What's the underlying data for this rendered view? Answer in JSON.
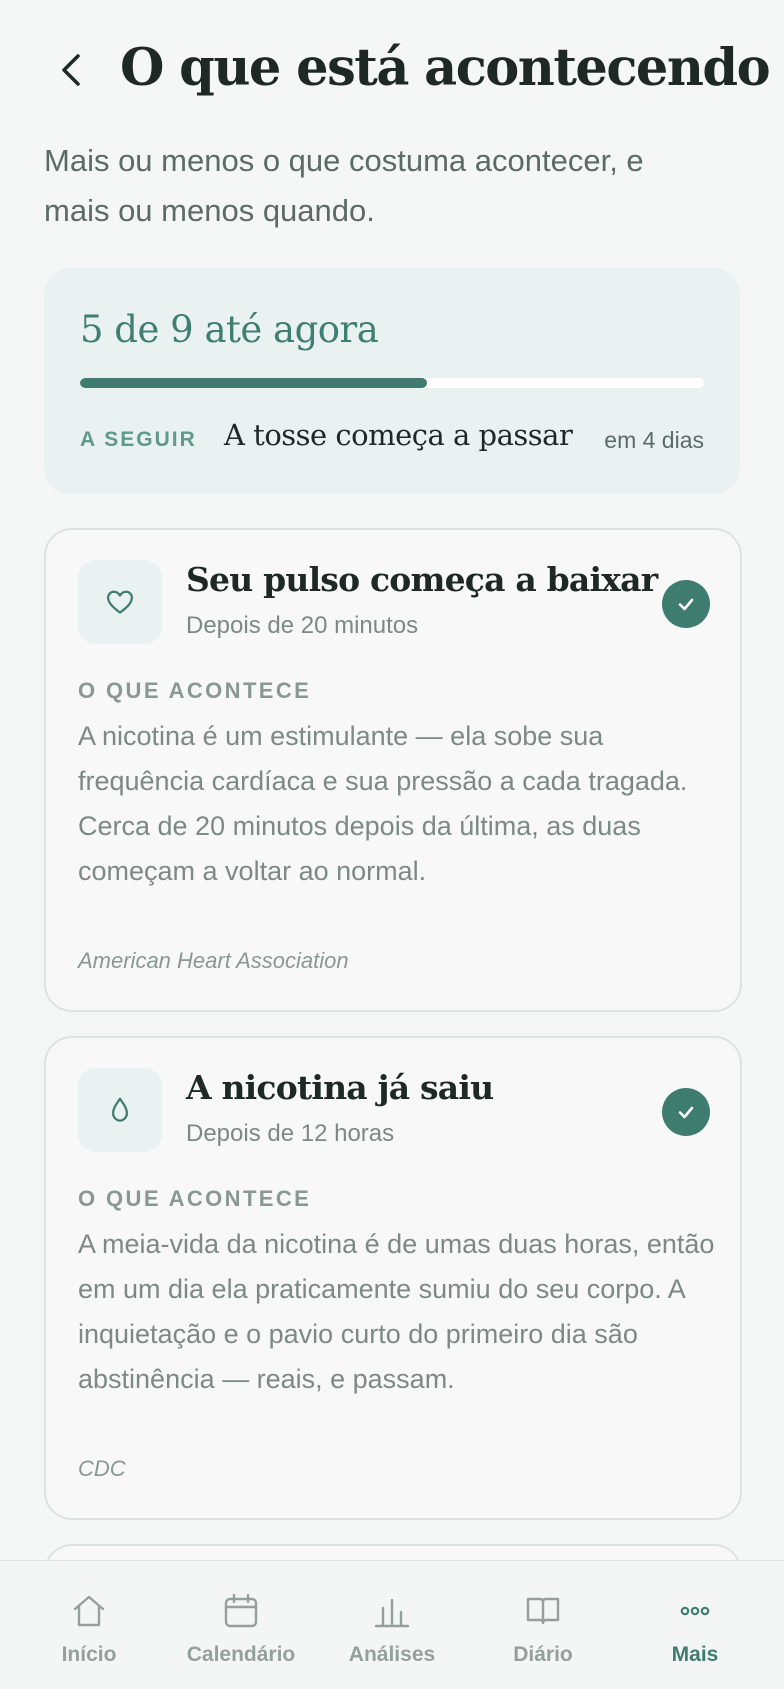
{
  "header": {
    "title": "O que está acontecendo",
    "subtitle": "Mais ou menos o que costuma acontecer, e mais ou menos quando."
  },
  "progress": {
    "title": "5 de 9 até agora",
    "completed": 5,
    "total": 9,
    "fraction": 0.556,
    "next_label": "A SEGUIR",
    "next_title": "A tosse começa a passar",
    "next_when": "em 4 dias"
  },
  "milestones": [
    {
      "icon": "heart-icon",
      "title": "Seu pulso começa a baixar",
      "time": "Depois de 20 minutos",
      "section_label": "O QUE ACONTECE",
      "body": "A nicotina é um estimulante — ela sobe sua frequência cardíaca e sua pressão a cada tragada. Cerca de 20 minutos depois da última, as duas começam a voltar ao normal.",
      "source": "American Heart Association",
      "done": true
    },
    {
      "icon": "droplet-icon",
      "title": "A nicotina já saiu",
      "time": "Depois de 12 horas",
      "section_label": "O QUE ACONTECE",
      "body": "A meia-vida da nicotina é de umas duas horas, então em um dia ela praticamente sumiu do seu corpo. A inquietação e o pavio curto do primeiro dia são abstinência — reais, e passam.",
      "source": "CDC",
      "done": true
    }
  ],
  "tabbar": {
    "items": [
      {
        "label": "Início",
        "icon": "home-icon"
      },
      {
        "label": "Calendário",
        "icon": "calendar-icon"
      },
      {
        "label": "Análises",
        "icon": "chart-icon"
      },
      {
        "label": "Diário",
        "icon": "book-icon"
      },
      {
        "label": "Mais",
        "icon": "more-icon",
        "active": true
      }
    ]
  },
  "colors": {
    "accent": "#3f7c70",
    "background": "#f5f7f6",
    "card_tint": "#e9f2f0"
  }
}
